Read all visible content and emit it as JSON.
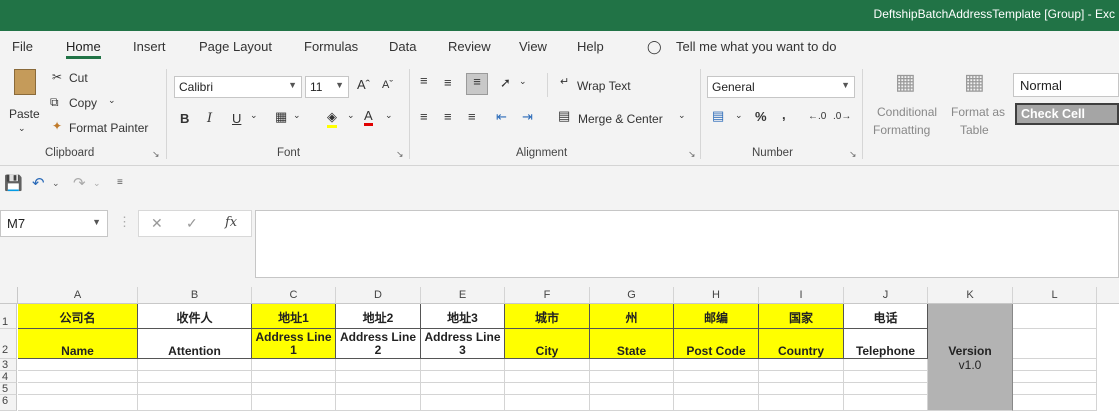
{
  "window": {
    "title": "DeftshipBatchAddressTemplate [Group] - Exc"
  },
  "menu": {
    "tabs": [
      "File",
      "Home",
      "Insert",
      "Page Layout",
      "Formulas",
      "Data",
      "Review",
      "View",
      "Help"
    ],
    "tell_me": "Tell me what you want to do"
  },
  "ribbon": {
    "clipboard": {
      "paste": "Paste",
      "cut": "Cut",
      "copy": "Copy",
      "format_painter": "Format Painter",
      "label": "Clipboard"
    },
    "font": {
      "name": "Calibri",
      "size": "11",
      "bold": "B",
      "italic": "I",
      "underline": "U",
      "label": "Font"
    },
    "alignment": {
      "wrap_text": "Wrap Text",
      "merge_center": "Merge & Center",
      "label": "Alignment"
    },
    "number": {
      "format": "General",
      "percent": "%",
      "comma": ",",
      "label": "Number"
    },
    "styles": {
      "conditional_1": "Conditional",
      "conditional_2": "Formatting",
      "format_as_1": "Format as",
      "format_as_2": "Table",
      "normal": "Normal",
      "check_cell": "Check Cell"
    }
  },
  "formula_bar": {
    "name_box": "M7",
    "fx": "fx",
    "value": ""
  },
  "grid": {
    "columns": [
      "A",
      "B",
      "C",
      "D",
      "E",
      "F",
      "G",
      "H",
      "I",
      "J",
      "K",
      "L"
    ],
    "rows": [
      "1",
      "2",
      "3",
      "4",
      "5",
      "6"
    ],
    "row1": [
      "公司名",
      "收件人",
      "地址1",
      "地址2",
      "地址3",
      "城市",
      "州",
      "邮编",
      "国家",
      "电话"
    ],
    "row2": [
      "Name",
      "Attention",
      "Address Line 1",
      "Address Line 2",
      "Address Line 3",
      "City",
      "State",
      "Post Code",
      "Country",
      "Telephone"
    ],
    "version_label": "Version",
    "version_value": "v1.0"
  },
  "colors": {
    "accent": "#217346",
    "highlight": "#ffff00",
    "version_fill": "#b3b3b3"
  }
}
